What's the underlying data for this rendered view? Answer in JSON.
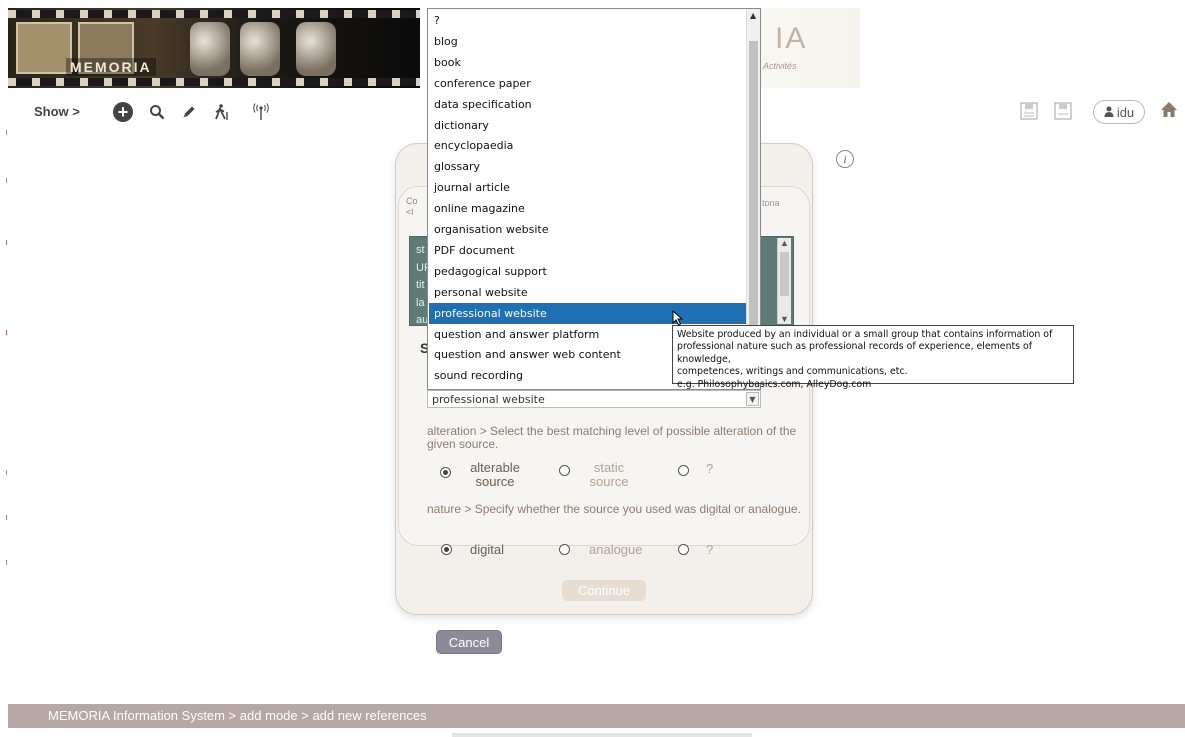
{
  "banner": {
    "logo": "MEMORIA",
    "title_suffix": "IA",
    "tagline": "Activités"
  },
  "toolbar": {
    "show_label": "Show >",
    "tools": [
      "add-icon",
      "search-icon",
      "pencil-icon",
      "hiking-icon",
      "broadcast-icon"
    ],
    "user": "idu",
    "user_icon": "user-icon",
    "home_icon": "home-icon"
  },
  "dialog": {
    "crumb_left_line1": "Co",
    "crumb_left_line2": "<l",
    "crumb_right": "tona",
    "teal_lines": [
      "st",
      "UF",
      "tit",
      "la",
      "au"
    ],
    "section_label": "S",
    "type_select": {
      "value": "professional website"
    },
    "alteration": {
      "question": "alteration > Select the best matching level of possible alteration of the given source.",
      "options": [
        {
          "label": "alterable source",
          "checked": true
        },
        {
          "label": "static source",
          "checked": false
        },
        {
          "label": "?",
          "checked": false
        }
      ]
    },
    "nature": {
      "question": "nature > Specify whether the source you used was digital or analogue.",
      "options": [
        {
          "label": "digital",
          "checked": true
        },
        {
          "label": "analogue",
          "checked": false
        },
        {
          "label": "?",
          "checked": false
        }
      ]
    },
    "continue_label": "Continue",
    "cancel_label": "Cancel"
  },
  "dropdown": {
    "items": [
      "?",
      "blog",
      "book",
      "conference paper",
      "data specification",
      "dictionary",
      "encyclopaedia",
      "glossary",
      "journal article",
      "online magazine",
      "organisation website",
      "PDF document",
      "pedagogical support",
      "personal website",
      "professional website",
      "question and answer platform",
      "question and answer web content",
      "sound recording"
    ],
    "selected_index": 14
  },
  "tooltip": {
    "lines": [
      "Website produced by an individual or a small group that contains information of",
      "professional nature such as professional records of experience, elements of knowledge,",
      "competences, writings and communications, etc.",
      "e.g. Philosophybasics.com, AlleyDog.com"
    ]
  },
  "footer": {
    "breadcrumb": "MEMORIA  Information System  >  add mode > add new references"
  },
  "colors": {
    "selection": "#1f6fb5",
    "footer_bg": "#b6a8a4",
    "teal_panel": "#5f7b78",
    "cancel_bg": "#8e8a9a"
  }
}
